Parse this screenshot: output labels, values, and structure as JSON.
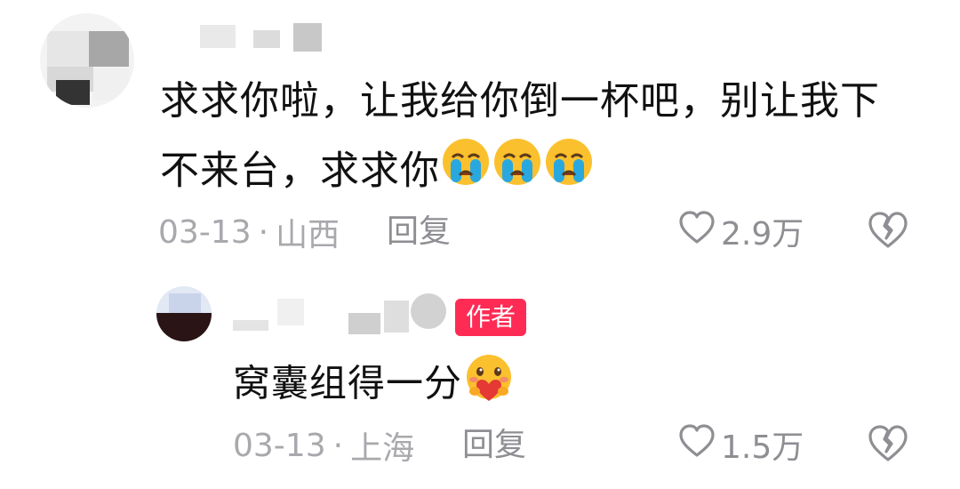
{
  "comment": {
    "text": "求求你啦，让我给你倒一杯吧，别让我下不来台，求求你",
    "emojis": [
      "crying-emoji",
      "crying-emoji",
      "crying-emoji"
    ],
    "date": "03-13",
    "separator": "·",
    "location": "山西",
    "reply_label": "回复",
    "likes": "2.9万"
  },
  "reply": {
    "badge": "作者",
    "text": "窝囊组得一分",
    "emoji": "heart-hug-emoji",
    "date": "03-13",
    "separator": "·",
    "location": "上海",
    "reply_label": "回复",
    "likes": "1.5万"
  },
  "colors": {
    "badge": "#fe2c55",
    "meta": "#a8a8ad",
    "emoji_yellow": "#fbc02d",
    "emoji_tear": "#29a8e0"
  }
}
